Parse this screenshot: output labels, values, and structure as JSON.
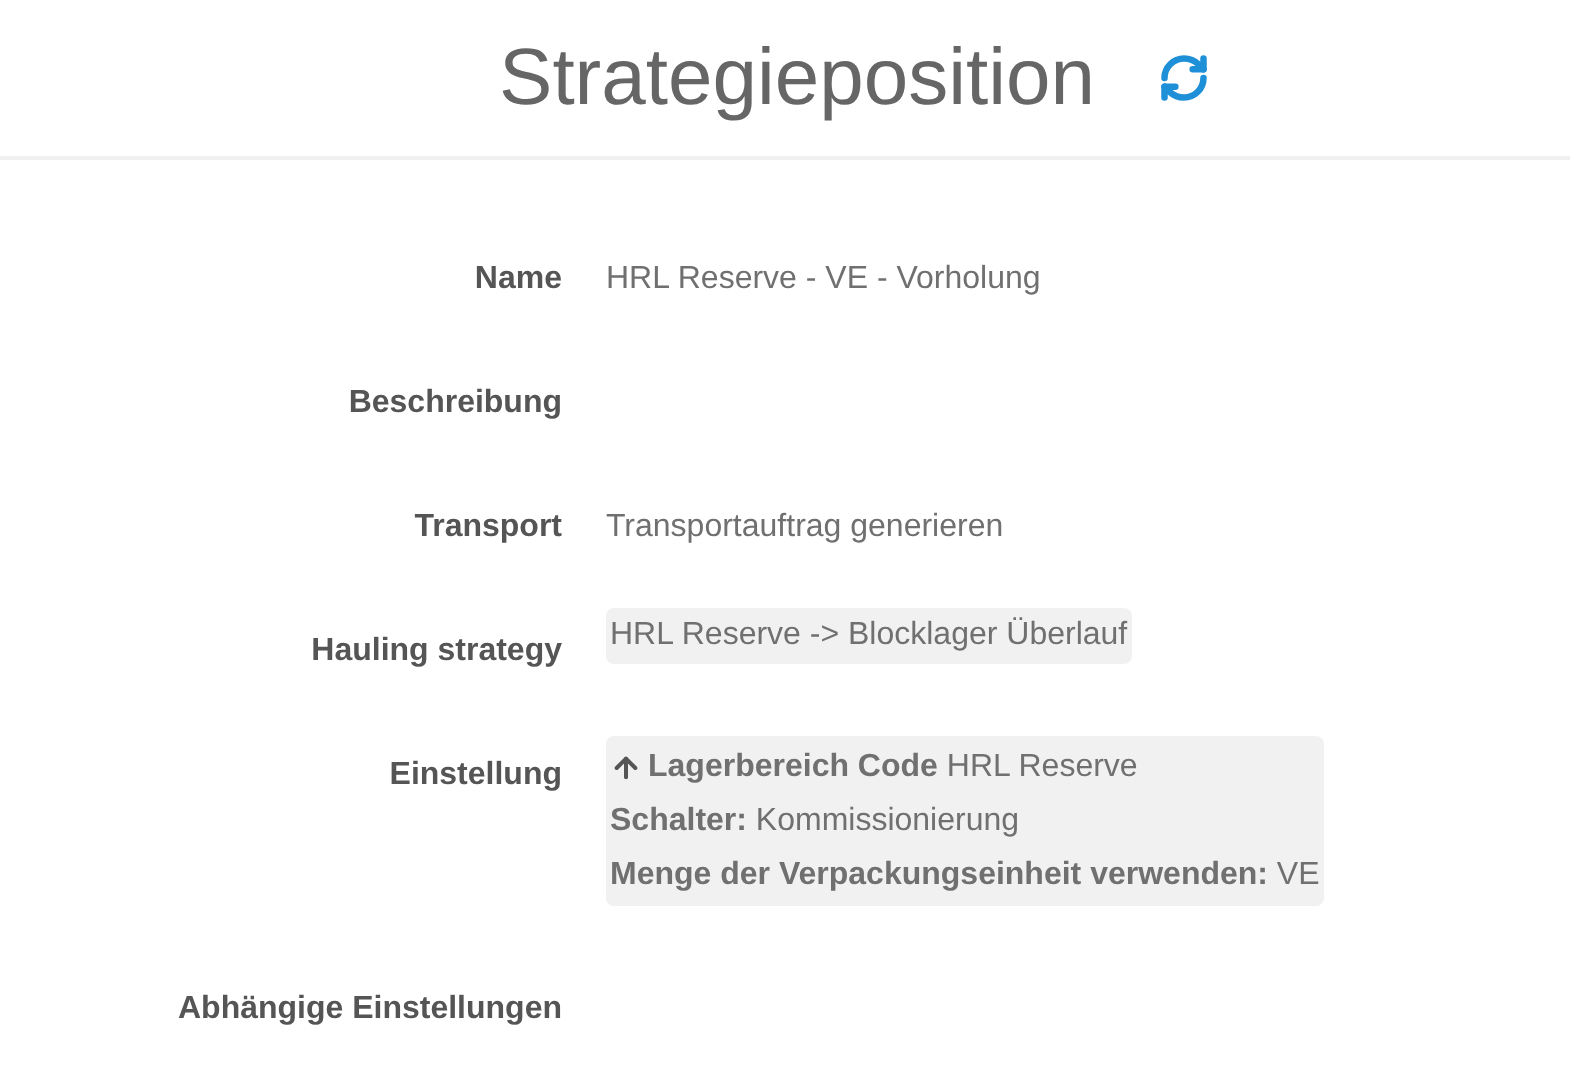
{
  "header": {
    "title": "Strategieposition"
  },
  "fields": [
    {
      "label": "Name",
      "kind": "text",
      "value": "HRL Reserve - VE - Vorholung"
    },
    {
      "label": "Beschreibung",
      "kind": "empty"
    },
    {
      "label": "Transport",
      "kind": "text",
      "value": "Transportauftrag generieren"
    },
    {
      "label": "Hauling strategy",
      "kind": "chip",
      "value": "HRL Reserve -> Blocklager Überlauf"
    },
    {
      "label": "Einstellung",
      "kind": "lines",
      "lines": [
        "**Lagerbereich Code** HRL Reserve",
        "**Schalter:** Kommissionierung",
        "**Menge der Verpackungseinheit verwenden:** VE"
      ]
    },
    {
      "label": "Abhängige Einstellungen",
      "kind": "empty"
    }
  ]
}
